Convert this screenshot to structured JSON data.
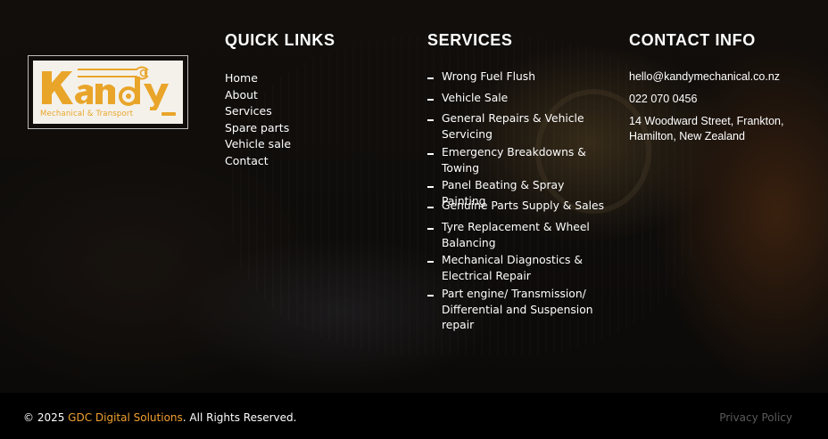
{
  "brand": {
    "logo_text": "Kandy",
    "logo_tagline": "Mechanical & Transport",
    "accent_color": "#e9a52a"
  },
  "quick_links": {
    "title": "QUICK LINKS",
    "items": [
      "Home",
      "About",
      "Services",
      "Spare parts",
      "Vehicle sale",
      "Contact"
    ]
  },
  "services": {
    "title": "SERVICES",
    "items": [
      "Wrong Fuel Flush",
      "Vehicle Sale",
      "General Repairs & Vehicle Servicing",
      "Emergency Breakdowns & Towing",
      "Panel Beating & Spray Painting",
      "Genuine Parts Supply & Sales",
      "Tyre Replacement & Wheel Balancing",
      "Mechanical Diagnostics & Electrical Repair",
      "Part engine/ Transmission/ Differential and Suspension repair"
    ]
  },
  "contact": {
    "title": "CONTACT INFO",
    "email": "hello@kandymechanical.co.nz",
    "phone": "022 070 0456",
    "address": "14 Woodward Street, Frankton, Hamilton, New Zealand"
  },
  "footer": {
    "copy_prefix": "© 2025 ",
    "company": "GDC Digital Solutions",
    "copy_suffix": ". All Rights Reserved.",
    "privacy": "Privacy Policy",
    "company_color": "#f0a030"
  }
}
